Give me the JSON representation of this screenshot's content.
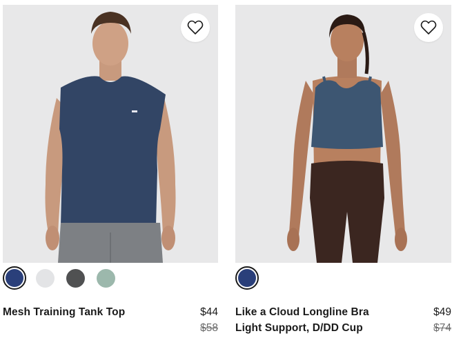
{
  "products": [
    {
      "name_lines": [
        "Mesh Training Tank Top"
      ],
      "price": "$44",
      "original_price": "$58",
      "wishlist_icon": "heart-outline-icon",
      "swatches": [
        {
          "color": "#2a3f7a",
          "selected": true
        },
        {
          "color": "#e3e4e6",
          "selected": false
        },
        {
          "color": "#505152",
          "selected": false
        },
        {
          "color": "#9cb8ac",
          "selected": false
        }
      ]
    },
    {
      "name_lines": [
        "Like a Cloud Longline Bra",
        "Light Support, D/DD Cup"
      ],
      "price": "$49",
      "original_price": "$74",
      "wishlist_icon": "heart-outline-icon",
      "swatches": [
        {
          "color": "#2a3f7a",
          "selected": true
        }
      ]
    }
  ]
}
